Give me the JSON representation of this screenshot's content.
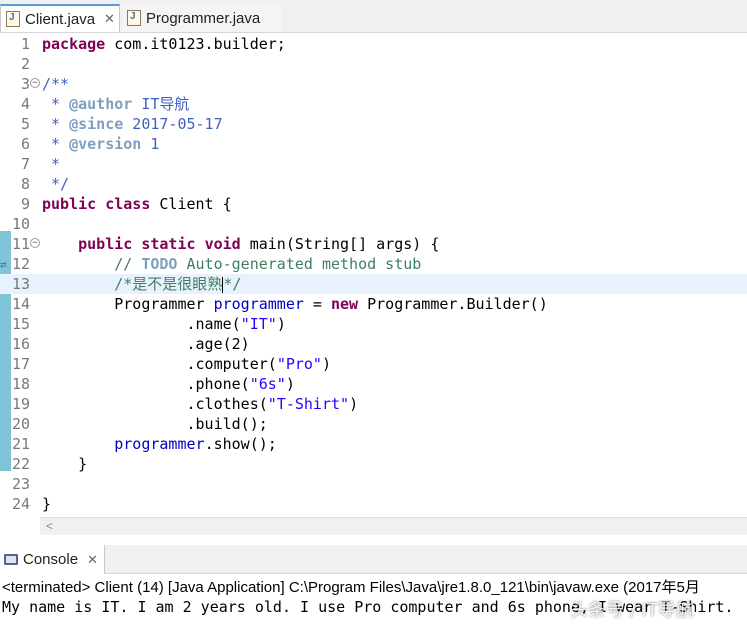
{
  "tabs": [
    {
      "label": "Client.java",
      "active": true
    },
    {
      "label": "Programmer.java",
      "active": false
    }
  ],
  "editor": {
    "lines": [
      {
        "num": "1",
        "segments": [
          {
            "t": "package",
            "c": "kw"
          },
          {
            "t": " com.it0123.builder;",
            "c": ""
          }
        ]
      },
      {
        "num": "2",
        "segments": []
      },
      {
        "num": "3",
        "fold": true,
        "segments": [
          {
            "t": "/**",
            "c": "jd"
          }
        ]
      },
      {
        "num": "4",
        "segments": [
          {
            "t": " * ",
            "c": "jd"
          },
          {
            "t": "@author",
            "c": "jdtag"
          },
          {
            "t": " IT导航",
            "c": "jd"
          }
        ]
      },
      {
        "num": "5",
        "segments": [
          {
            "t": " * ",
            "c": "jd"
          },
          {
            "t": "@since",
            "c": "jdtag"
          },
          {
            "t": " 2017-05-17",
            "c": "jd"
          }
        ]
      },
      {
        "num": "6",
        "segments": [
          {
            "t": " * ",
            "c": "jd"
          },
          {
            "t": "@version",
            "c": "jdtag"
          },
          {
            "t": " 1",
            "c": "jd"
          }
        ]
      },
      {
        "num": "7",
        "segments": [
          {
            "t": " *",
            "c": "jd"
          }
        ]
      },
      {
        "num": "8",
        "segments": [
          {
            "t": " */",
            "c": "jd"
          }
        ]
      },
      {
        "num": "9",
        "segments": [
          {
            "t": "public",
            "c": "kw"
          },
          {
            "t": " ",
            "c": ""
          },
          {
            "t": "class",
            "c": "kw"
          },
          {
            "t": " Client {",
            "c": ""
          }
        ]
      },
      {
        "num": "10",
        "segments": []
      },
      {
        "num": "11",
        "fold": true,
        "segments": [
          {
            "t": "    ",
            "c": ""
          },
          {
            "t": "public",
            "c": "kw"
          },
          {
            "t": " ",
            "c": ""
          },
          {
            "t": "static",
            "c": "kw"
          },
          {
            "t": " ",
            "c": ""
          },
          {
            "t": "void",
            "c": "kw"
          },
          {
            "t": " main(String[] args) {",
            "c": ""
          }
        ]
      },
      {
        "num": "12",
        "segments": [
          {
            "t": "        ",
            "c": ""
          },
          {
            "t": "// ",
            "c": "cmt"
          },
          {
            "t": "TODO",
            "c": "todo"
          },
          {
            "t": " Auto-generated method stub",
            "c": "cmt"
          }
        ]
      },
      {
        "num": "13",
        "highlight": true,
        "segments": [
          {
            "t": "        ",
            "c": ""
          },
          {
            "t": "/*是不是很眼熟",
            "c": "cmt"
          },
          {
            "t": "",
            "c": "caret"
          },
          {
            "t": "*/",
            "c": "cmt"
          }
        ]
      },
      {
        "num": "14",
        "segments": [
          {
            "t": "        Programmer ",
            "c": ""
          },
          {
            "t": "programmer",
            "c": "field"
          },
          {
            "t": " = ",
            "c": ""
          },
          {
            "t": "new",
            "c": "kw"
          },
          {
            "t": " Programmer.Builder()",
            "c": ""
          }
        ]
      },
      {
        "num": "15",
        "segments": [
          {
            "t": "                .name(",
            "c": ""
          },
          {
            "t": "\"IT\"",
            "c": "str"
          },
          {
            "t": ")",
            "c": ""
          }
        ]
      },
      {
        "num": "16",
        "segments": [
          {
            "t": "                .age(2)",
            "c": ""
          }
        ]
      },
      {
        "num": "17",
        "segments": [
          {
            "t": "                .computer(",
            "c": ""
          },
          {
            "t": "\"Pro\"",
            "c": "str"
          },
          {
            "t": ")",
            "c": ""
          }
        ]
      },
      {
        "num": "18",
        "segments": [
          {
            "t": "                .phone(",
            "c": ""
          },
          {
            "t": "\"6s\"",
            "c": "str"
          },
          {
            "t": ")",
            "c": ""
          }
        ]
      },
      {
        "num": "19",
        "segments": [
          {
            "t": "                .clothes(",
            "c": ""
          },
          {
            "t": "\"T-Shirt\"",
            "c": "str"
          },
          {
            "t": ")",
            "c": ""
          }
        ]
      },
      {
        "num": "20",
        "segments": [
          {
            "t": "                .build();",
            "c": ""
          }
        ]
      },
      {
        "num": "21",
        "segments": [
          {
            "t": "        ",
            "c": ""
          },
          {
            "t": "programmer",
            "c": "field"
          },
          {
            "t": ".show();",
            "c": ""
          }
        ]
      },
      {
        "num": "22",
        "segments": [
          {
            "t": "    }",
            "c": ""
          }
        ]
      },
      {
        "num": "23",
        "segments": []
      },
      {
        "num": "24",
        "segments": [
          {
            "t": "}",
            "c": ""
          }
        ]
      }
    ]
  },
  "console": {
    "tab_label": "Console",
    "status": "<terminated> Client (14) [Java Application] C:\\Program Files\\Java\\jre1.8.0_121\\bin\\javaw.exe (2017年5月",
    "output": "My name is IT. I am 2 years old. I use Pro computer and 6s phone, I wear T-Shirt."
  },
  "watermark": "头条号 / IT导航",
  "icons": {
    "java_file": "java-file-icon",
    "close": "close-icon",
    "console": "console-icon"
  }
}
